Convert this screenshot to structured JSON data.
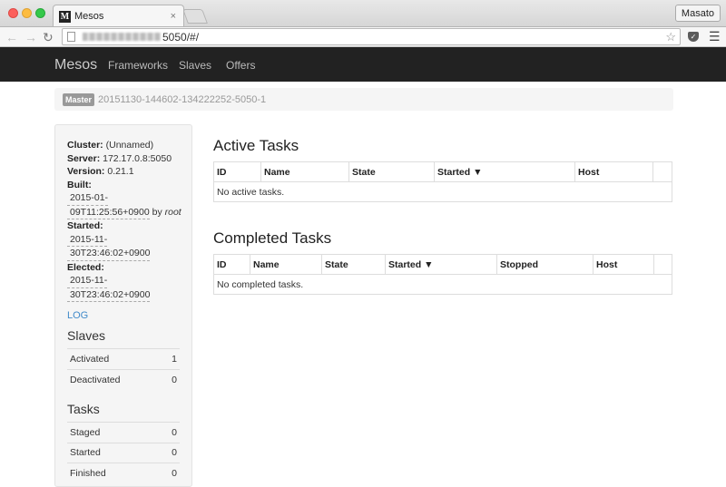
{
  "browser": {
    "tab_title": "Mesos",
    "tab_close": "×",
    "favicon_letter": "M",
    "user_button": "Masato",
    "url_suffix": "5050/#/"
  },
  "navbar": {
    "brand": "Mesos",
    "links": [
      "Frameworks",
      "Slaves",
      "Offers"
    ]
  },
  "breadcrumb": {
    "label": "Master",
    "id": "20151130-144602-134222252-5050-1"
  },
  "sidebar": {
    "cluster_label": "Cluster:",
    "cluster_value": "(Unnamed)",
    "server_label": "Server:",
    "server_value": "172.17.0.8:5050",
    "version_label": "Version:",
    "version_value": "0.21.1",
    "built_label": "Built:",
    "built_line1": "2015-01-",
    "built_line2": "09T11:25:56+0900",
    "built_by": "by",
    "built_user": "root",
    "started_label": "Started:",
    "started_line1": "2015-11-",
    "started_line2": "30T23:46:02+0900",
    "elected_label": "Elected:",
    "elected_line1": "2015-11-",
    "elected_line2": "30T23:46:02+0900",
    "log_link": "LOG",
    "slaves_heading": "Slaves",
    "slaves": [
      {
        "label": "Activated",
        "value": "1"
      },
      {
        "label": "Deactivated",
        "value": "0"
      }
    ],
    "tasks_heading": "Tasks",
    "tasks": [
      {
        "label": "Staged",
        "value": "0"
      },
      {
        "label": "Started",
        "value": "0"
      },
      {
        "label": "Finished",
        "value": "0"
      }
    ]
  },
  "active_tasks": {
    "heading": "Active Tasks",
    "columns": [
      "ID",
      "Name",
      "State",
      "Started ▼",
      "Host",
      ""
    ],
    "empty_message": "No active tasks."
  },
  "completed_tasks": {
    "heading": "Completed Tasks",
    "columns": [
      "ID",
      "Name",
      "State",
      "Started ▼",
      "Stopped",
      "Host",
      ""
    ],
    "empty_message": "No completed tasks."
  }
}
